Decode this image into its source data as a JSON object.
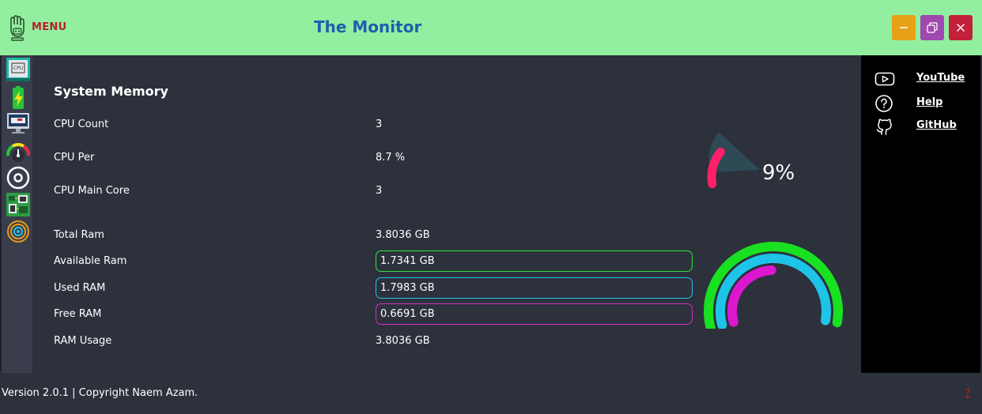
{
  "header": {
    "menu_label": "MENU",
    "title": "The Monitor",
    "logo_icon": "hand-robot-icon",
    "buttons": {
      "minimize_icon": "minimize-icon",
      "maximize_icon": "restore-icon",
      "close_icon": "close-icon"
    }
  },
  "sidebar": {
    "items": [
      {
        "icon": "cpu-chip-icon"
      },
      {
        "icon": "battery-charging-icon"
      },
      {
        "icon": "system-monitor-icon"
      },
      {
        "icon": "speedometer-icon"
      },
      {
        "icon": "disk-icon"
      },
      {
        "icon": "circuit-board-icon"
      },
      {
        "icon": "network-signal-icon"
      }
    ]
  },
  "main": {
    "section_title": "System Memory",
    "cpu_count_label": "CPU Count",
    "cpu_count_value": "3",
    "cpu_per_label": "CPU Per",
    "cpu_per_value": "8.7 %",
    "cpu_main_core_label": "CPU Main Core",
    "cpu_main_core_value": "3",
    "total_ram_label": "Total Ram",
    "total_ram_value": "3.8036 GB",
    "available_ram_label": "Available Ram",
    "available_ram_value": "1.7341 GB",
    "used_ram_label": "Used RAM",
    "used_ram_value": "1.7983 GB",
    "free_ram_label": "Free RAM",
    "free_ram_value": "0.6691 GB",
    "ram_usage_label": "RAM Usage",
    "ram_usage_value": "3.8036 GB"
  },
  "cpu_gauge": {
    "percent_text": "9%",
    "percent": 9,
    "color": "#ff1f6a"
  },
  "ram_gauge": {
    "available_fraction": 1.0,
    "used_fraction": 1.0,
    "free_fraction": 0.5,
    "colors": {
      "available": "#19e021",
      "used": "#1ec4e8",
      "free": "#dd17cf"
    }
  },
  "links": {
    "youtube": "YouTube",
    "help": "Help",
    "github": "GitHub"
  },
  "footer": {
    "version_text": "Version 2.0.1 | Copyright Naem Azam.",
    "help_mark": "?"
  },
  "colors": {
    "titlebar": "#91ef9f",
    "title_text": "#1f5eaf",
    "menu_text": "#b3202a",
    "background": "#2c313c",
    "sidebar": "#3a3d4b",
    "panel": "#000000",
    "minimize": "#e7a116",
    "maximize": "#9f48b0",
    "close": "#c3203a"
  }
}
